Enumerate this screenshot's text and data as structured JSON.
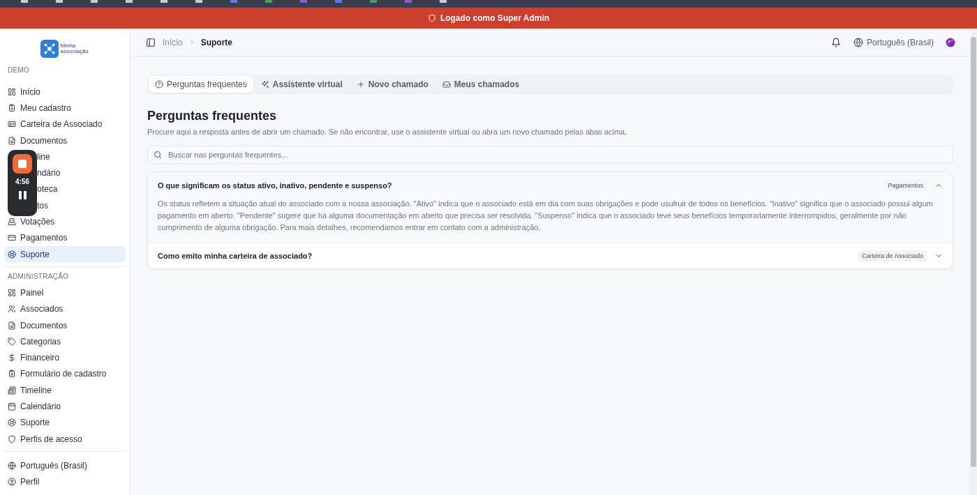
{
  "banner": {
    "text": "Logado como Super Admin"
  },
  "sidebar": {
    "logo_text": "Minha associação",
    "section": "DEMO",
    "items": [
      {
        "label": "Início",
        "kind": "item",
        "selected": false
      },
      {
        "label": "Meu cadastro",
        "kind": "item",
        "selected": false
      },
      {
        "label": "Carteira de Associado",
        "kind": "item",
        "selected": false
      },
      {
        "label": "Documentos",
        "kind": "item",
        "selected": false
      },
      {
        "label": "line",
        "kind": "covered",
        "selected": false
      },
      {
        "label": "ndário",
        "kind": "covered",
        "selected": false
      },
      {
        "label": "oteca",
        "kind": "covered",
        "selected": false
      },
      {
        "label": "tos",
        "kind": "covered",
        "selected": false
      },
      {
        "label": "Votações",
        "kind": "item",
        "selected": false
      },
      {
        "label": "Pagamentos",
        "kind": "item",
        "selected": false
      },
      {
        "label": "Suporte",
        "kind": "item",
        "selected": true
      }
    ],
    "admin_section": "ADMINISTRAÇÃO",
    "admin_items": [
      {
        "label": "Painel",
        "selected": false
      },
      {
        "label": "Associados",
        "selected": false
      },
      {
        "label": "Documentos",
        "selected": false
      },
      {
        "label": "Categorias",
        "selected": false
      },
      {
        "label": "Financeiro",
        "selected": false
      },
      {
        "label": "Formulário de cadastro",
        "selected": false
      },
      {
        "label": "Timeline",
        "selected": false
      },
      {
        "label": "Calendário",
        "selected": false
      },
      {
        "label": "Suporte",
        "selected": false
      },
      {
        "label": "Perfis de acesso",
        "selected": false
      }
    ],
    "footer_items": [
      "Português (Brasil)",
      "Perfil"
    ]
  },
  "recorder": {
    "time": "4:56"
  },
  "header": {
    "breadcrumb": [
      "Início",
      "Suporte"
    ],
    "language": "Português (Brasil)"
  },
  "tabs": [
    {
      "label": "Perguntas frequentes",
      "selected": true
    },
    {
      "label": "Assistente virtual",
      "selected": false
    },
    {
      "label": "Novo chamado",
      "selected": false
    },
    {
      "label": "Meus chamados",
      "selected": false
    }
  ],
  "page": {
    "title": "Perguntas frequentes",
    "subtitle": "Procure aqui a resposta antes de abrir um chamado. Se não encontrar, use o assistente virtual ou abra um novo chamado pelas abas acima."
  },
  "search": {
    "placeholder": "Buscar nas perguntas frequentes..."
  },
  "faqs": [
    {
      "question": "O que significam os status ativo, inativo, pendente e suspenso?",
      "category": "Pagamentos",
      "expanded": true,
      "answer": "Os status refletem a situação atual do associado com a nossa associação. \"Ativo\" indica que o associado está em dia com suas obrigações e pode usufruir de todos os benefícios. \"Inativo\" significa que o associado possui algum pagamento em aberto. \"Pendente\" sugere que há alguma documentação em aberto que precisa ser resolvida. \"Suspenso\" indica que o associado teve seus benefícios temporariamente interrompidos, geralmente por não cumprimento de alguma obrigação. Para mais detalhes, recomendamos entrar em contato com a administração."
    },
    {
      "question": "Como emito minha carteira de associado?",
      "category": "Carteira de Associado",
      "expanded": false
    }
  ]
}
